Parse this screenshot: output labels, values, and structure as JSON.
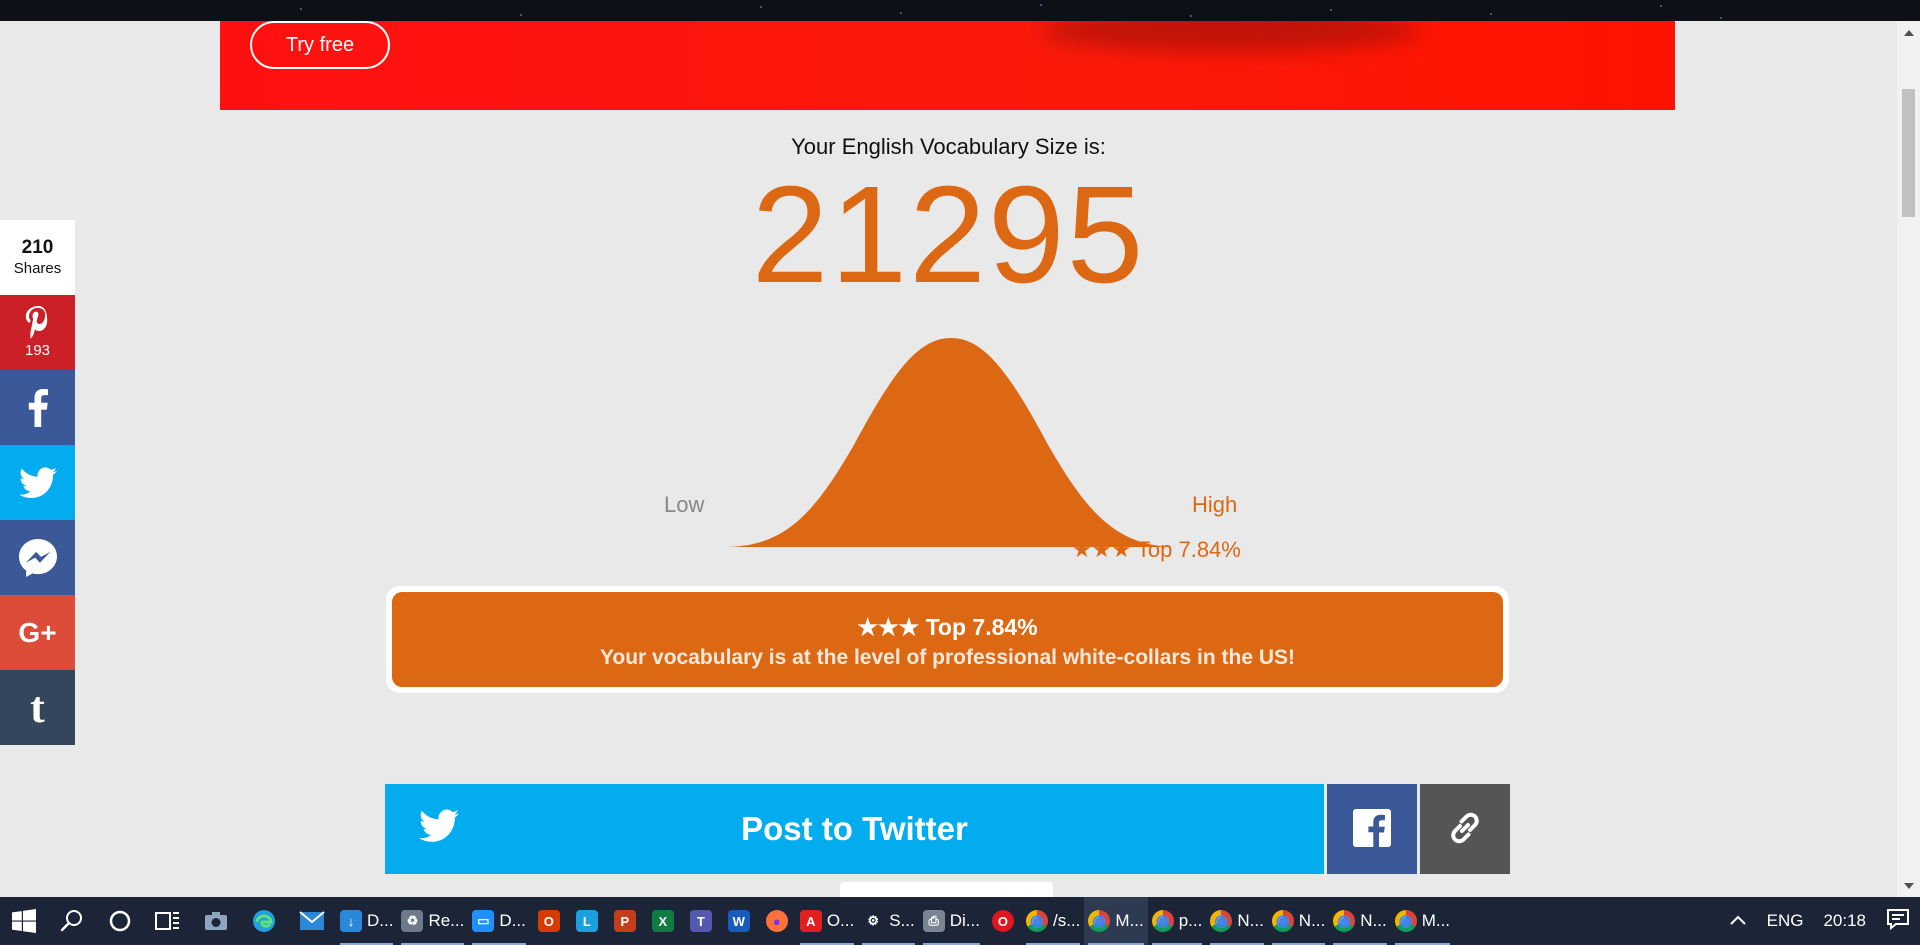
{
  "banner": {
    "try_free_label": "Try free"
  },
  "result": {
    "heading": "Your English Vocabulary Size is:",
    "size": "21295",
    "low_label": "Low",
    "high_label": "High",
    "rank_small": "★★★ Top 7.84%",
    "rank_box": "★★★ Top 7.84%",
    "message": "Your vocabulary is at the level of professional white-collars in the US!"
  },
  "share_actions": {
    "twitter_label": "Post to Twitter"
  },
  "share_bar": {
    "total": "210",
    "total_label": "Shares",
    "pinterest_count": "193",
    "google_label": "G+",
    "tumblr_label": "t"
  },
  "taskbar": {
    "apps": [
      {
        "name": "download-app",
        "label": "D...",
        "icon": "download-icon",
        "color": "#2b88d8"
      },
      {
        "name": "recycle-app",
        "label": "Re...",
        "icon": "recycle-bin-icon",
        "color": "#6c7a8a"
      },
      {
        "name": "desktop-app",
        "label": "D...",
        "icon": "monitor-icon",
        "color": "#1e90ff"
      },
      {
        "name": "office-app",
        "label": "",
        "icon": "office-icon",
        "color": "#d83b01"
      },
      {
        "name": "l-app",
        "label": "",
        "icon": "letter-l-icon",
        "color": "#1aa0e0"
      },
      {
        "name": "powerpoint-app",
        "label": "",
        "icon": "powerpoint-icon",
        "color": "#c43e1c"
      },
      {
        "name": "excel-app",
        "label": "",
        "icon": "excel-icon",
        "color": "#107c41"
      },
      {
        "name": "teams-app",
        "label": "",
        "icon": "teams-icon",
        "color": "#5558af"
      },
      {
        "name": "word-app",
        "label": "",
        "icon": "word-icon",
        "color": "#185abd"
      },
      {
        "name": "firefox-app",
        "label": "",
        "icon": "firefox-icon",
        "color": "#ff7139"
      },
      {
        "name": "pdf-app",
        "label": "O...",
        "icon": "pdf-icon",
        "color": "#e02020"
      },
      {
        "name": "settings-app",
        "label": "S...",
        "icon": "gear-icon",
        "color": "#1c2538"
      },
      {
        "name": "printer-app",
        "label": "Di...",
        "icon": "printer-icon",
        "color": "#7a8594"
      },
      {
        "name": "opera-app",
        "label": "",
        "icon": "opera-icon",
        "color": "#e0161e"
      },
      {
        "name": "chrome-app-1",
        "label": "/s...",
        "icon": "chrome-icon",
        "color": "#e8a317"
      },
      {
        "name": "chrome-app-2",
        "label": "M...",
        "icon": "chrome-icon",
        "color": "#e8a317",
        "active": true
      },
      {
        "name": "chrome-app-3",
        "label": "p...",
        "icon": "chrome-icon",
        "color": "#e8a317"
      },
      {
        "name": "chrome-app-4",
        "label": "N...",
        "icon": "chrome-icon",
        "color": "#e8a317"
      },
      {
        "name": "chrome-app-5",
        "label": "N...",
        "icon": "chrome-icon",
        "color": "#e8a317"
      },
      {
        "name": "chrome-app-6",
        "label": "N...",
        "icon": "chrome-icon",
        "color": "#e8a317"
      },
      {
        "name": "chrome-app-7",
        "label": "M...",
        "icon": "chrome-icon",
        "color": "#e8a317"
      }
    ],
    "language": "ENG",
    "time": "20:18"
  },
  "colors": {
    "accent": "#dd6813",
    "banner_red": "#ff1010",
    "twitter": "#03acee",
    "facebook": "#3b5998"
  }
}
